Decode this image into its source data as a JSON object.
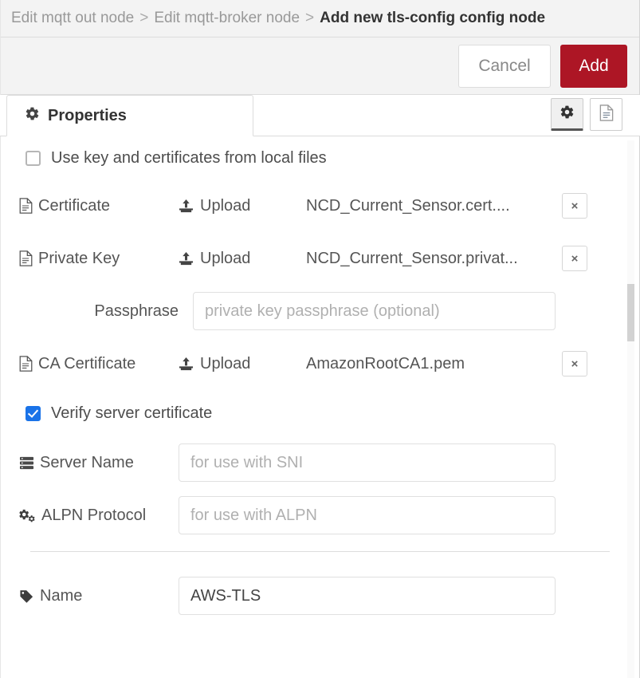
{
  "breadcrumb": {
    "items": [
      {
        "label": "Edit mqtt out node",
        "current": false
      },
      {
        "label": "Edit mqtt-broker node",
        "current": false
      },
      {
        "label": "Add new tls-config config node",
        "current": true
      }
    ],
    "separator": ">"
  },
  "actions": {
    "cancel_label": "Cancel",
    "add_label": "Add",
    "add_color": "#ad1625"
  },
  "tabs": {
    "properties": {
      "label": "Properties",
      "icon": "gear-icon"
    },
    "tools": [
      {
        "name": "gear-icon",
        "active": true
      },
      {
        "name": "document-icon",
        "active": false
      }
    ]
  },
  "form": {
    "use_local_files": {
      "label": "Use key and certificates from local files",
      "checked": false
    },
    "certificate": {
      "label": "Certificate",
      "icon": "file-icon",
      "upload_label": "Upload",
      "upload_icon": "upload-icon",
      "filename": "NCD_Current_Sensor.cert....",
      "delete_label": "×"
    },
    "private_key": {
      "label": "Private Key",
      "icon": "file-icon",
      "upload_label": "Upload",
      "upload_icon": "upload-icon",
      "filename": "NCD_Current_Sensor.privat...",
      "delete_label": "×"
    },
    "passphrase": {
      "label": "Passphrase",
      "value": "",
      "placeholder": "private key passphrase (optional)"
    },
    "ca_certificate": {
      "label": "CA Certificate",
      "icon": "file-icon",
      "upload_label": "Upload",
      "upload_icon": "upload-icon",
      "filename": "AmazonRootCA1.pem",
      "delete_label": "×"
    },
    "verify_server_certificate": {
      "label": "Verify server certificate",
      "checked": true,
      "accent_color": "#1a73e8"
    },
    "server_name": {
      "label": "Server Name",
      "icon": "server-icon",
      "value": "",
      "placeholder": "for use with SNI"
    },
    "alpn_protocol": {
      "label": "ALPN Protocol",
      "icon": "cogs-icon",
      "value": "",
      "placeholder": "for use with ALPN"
    },
    "name": {
      "label": "Name",
      "icon": "tag-icon",
      "value": "AWS-TLS",
      "placeholder": ""
    }
  }
}
